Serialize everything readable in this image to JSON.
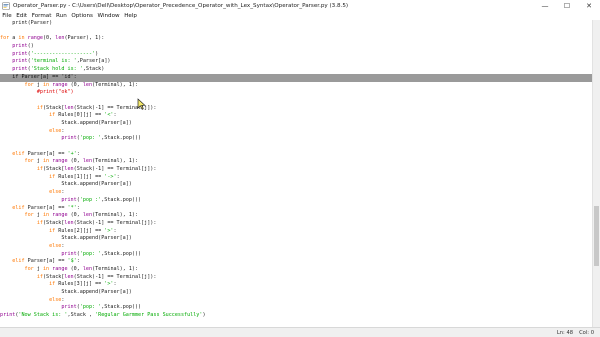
{
  "window": {
    "title": "Operator_Parser.py - C:\\Users\\Dell\\Desktop\\Operator_Precedence_Operator_with_Lex_Syntax\\Operator_Parser.py (3.8.5)",
    "minimize": "—",
    "maximize": "☐",
    "close": "✕"
  },
  "menu": [
    "File",
    "Edit",
    "Format",
    "Run",
    "Options",
    "Window",
    "Help"
  ],
  "code": [
    [
      {
        "t": "    print(Parser)"
      }
    ],
    [
      {
        "t": ""
      }
    ],
    [
      {
        "t": "for",
        "c": "kw"
      },
      {
        "t": " a "
      },
      {
        "t": "in",
        "c": "kw"
      },
      {
        "t": " "
      },
      {
        "t": "range",
        "c": "bi"
      },
      {
        "t": "(0, "
      },
      {
        "t": "len",
        "c": "bi"
      },
      {
        "t": "(Parser), 1):"
      }
    ],
    [
      {
        "t": "    "
      },
      {
        "t": "print",
        "c": "bi"
      },
      {
        "t": "()"
      }
    ],
    [
      {
        "t": "    "
      },
      {
        "t": "print",
        "c": "bi"
      },
      {
        "t": "("
      },
      {
        "t": "'-------------------'",
        "c": "str"
      },
      {
        "t": ")"
      }
    ],
    [
      {
        "t": "    "
      },
      {
        "t": "print",
        "c": "bi"
      },
      {
        "t": "("
      },
      {
        "t": "'terminal is: '",
        "c": "str"
      },
      {
        "t": ",Parser[a])"
      }
    ],
    [
      {
        "t": "    "
      },
      {
        "t": "print",
        "c": "bi"
      },
      {
        "t": "("
      },
      {
        "t": "'Stack hold is: '",
        "c": "str"
      },
      {
        "t": ",Stack)"
      }
    ],
    [
      {
        "t": "    if Parser[a] == 'id':"
      }
    ],
    [
      {
        "t": "        "
      },
      {
        "t": "for",
        "c": "kw"
      },
      {
        "t": " j "
      },
      {
        "t": "in",
        "c": "kw"
      },
      {
        "t": " "
      },
      {
        "t": "range",
        "c": "bi"
      },
      {
        "t": " (0, "
      },
      {
        "t": "len",
        "c": "bi"
      },
      {
        "t": "(Terminal), 1):"
      }
    ],
    [
      {
        "t": "            "
      },
      {
        "t": "#print(\"ok\")",
        "c": "cm"
      }
    ],
    [
      {
        "t": ""
      }
    ],
    [
      {
        "t": "            "
      },
      {
        "t": "if",
        "c": "kw"
      },
      {
        "t": "(Stack["
      },
      {
        "t": "len",
        "c": "bi"
      },
      {
        "t": "(Stack)-1] == Terminal[j]):"
      }
    ],
    [
      {
        "t": "                "
      },
      {
        "t": "if",
        "c": "kw"
      },
      {
        "t": " Rules[0][j] == "
      },
      {
        "t": "'<'",
        "c": "str"
      },
      {
        "t": ":"
      }
    ],
    [
      {
        "t": "                    Stack.append(Parser[a])"
      }
    ],
    [
      {
        "t": "                "
      },
      {
        "t": "else",
        "c": "kw"
      },
      {
        "t": ":"
      }
    ],
    [
      {
        "t": "                    "
      },
      {
        "t": "print",
        "c": "bi"
      },
      {
        "t": "("
      },
      {
        "t": "'pop: '",
        "c": "str"
      },
      {
        "t": ",Stack.pop())"
      }
    ],
    [
      {
        "t": ""
      }
    ],
    [
      {
        "t": "    "
      },
      {
        "t": "elif",
        "c": "kw"
      },
      {
        "t": " Parser[a] == "
      },
      {
        "t": "'+'",
        "c": "str"
      },
      {
        "t": ":"
      }
    ],
    [
      {
        "t": "        "
      },
      {
        "t": "for",
        "c": "kw"
      },
      {
        "t": " j "
      },
      {
        "t": "in",
        "c": "kw"
      },
      {
        "t": " "
      },
      {
        "t": "range",
        "c": "bi"
      },
      {
        "t": " (0, "
      },
      {
        "t": "len",
        "c": "bi"
      },
      {
        "t": "(Terminal), 1):"
      }
    ],
    [
      {
        "t": "            "
      },
      {
        "t": "if",
        "c": "kw"
      },
      {
        "t": "(Stack["
      },
      {
        "t": "len",
        "c": "bi"
      },
      {
        "t": "(Stack)-1] == Terminal[j]):"
      }
    ],
    [
      {
        "t": "                "
      },
      {
        "t": "if",
        "c": "kw"
      },
      {
        "t": " Rules[1][j] == "
      },
      {
        "t": "'->'",
        "c": "str"
      },
      {
        "t": ":"
      }
    ],
    [
      {
        "t": "                    Stack.append(Parser[a])"
      }
    ],
    [
      {
        "t": "                "
      },
      {
        "t": "else",
        "c": "kw"
      },
      {
        "t": ":"
      }
    ],
    [
      {
        "t": "                    "
      },
      {
        "t": "print",
        "c": "bi"
      },
      {
        "t": "("
      },
      {
        "t": "'pop :'",
        "c": "str"
      },
      {
        "t": ",Stack.pop())"
      }
    ],
    [
      {
        "t": "    "
      },
      {
        "t": "elif",
        "c": "kw"
      },
      {
        "t": " Parser[a] == "
      },
      {
        "t": "'*'",
        "c": "str"
      },
      {
        "t": ":"
      }
    ],
    [
      {
        "t": "        "
      },
      {
        "t": "for",
        "c": "kw"
      },
      {
        "t": " j "
      },
      {
        "t": "in",
        "c": "kw"
      },
      {
        "t": " "
      },
      {
        "t": "range",
        "c": "bi"
      },
      {
        "t": " (0, "
      },
      {
        "t": "len",
        "c": "bi"
      },
      {
        "t": "(Terminal), 1):"
      }
    ],
    [
      {
        "t": "            "
      },
      {
        "t": "if",
        "c": "kw"
      },
      {
        "t": "(Stack["
      },
      {
        "t": "len",
        "c": "bi"
      },
      {
        "t": "(Stack)-1] == Terminal[j]):"
      }
    ],
    [
      {
        "t": "                "
      },
      {
        "t": "if",
        "c": "kw"
      },
      {
        "t": " Rules[2][j] == "
      },
      {
        "t": "'>'",
        "c": "str"
      },
      {
        "t": ":"
      }
    ],
    [
      {
        "t": "                    Stack.append(Parser[a])"
      }
    ],
    [
      {
        "t": "                "
      },
      {
        "t": "else",
        "c": "kw"
      },
      {
        "t": ":"
      }
    ],
    [
      {
        "t": "                    "
      },
      {
        "t": "print",
        "c": "bi"
      },
      {
        "t": "("
      },
      {
        "t": "'pop: '",
        "c": "str"
      },
      {
        "t": ",Stack.pop())"
      }
    ],
    [
      {
        "t": "    "
      },
      {
        "t": "elif",
        "c": "kw"
      },
      {
        "t": " Parser[a] == "
      },
      {
        "t": "'$'",
        "c": "str"
      },
      {
        "t": ":"
      }
    ],
    [
      {
        "t": "        "
      },
      {
        "t": "for",
        "c": "kw"
      },
      {
        "t": " j "
      },
      {
        "t": "in",
        "c": "kw"
      },
      {
        "t": " "
      },
      {
        "t": "range",
        "c": "bi"
      },
      {
        "t": " (0, "
      },
      {
        "t": "len",
        "c": "bi"
      },
      {
        "t": "(Terminal), 1):"
      }
    ],
    [
      {
        "t": "            "
      },
      {
        "t": "if",
        "c": "kw"
      },
      {
        "t": "(Stack["
      },
      {
        "t": "len",
        "c": "bi"
      },
      {
        "t": "(Stack)-1] == Terminal[j]):"
      }
    ],
    [
      {
        "t": "                "
      },
      {
        "t": "if",
        "c": "kw"
      },
      {
        "t": " Rules[3][j] == "
      },
      {
        "t": "'>'",
        "c": "str"
      },
      {
        "t": ":"
      }
    ],
    [
      {
        "t": "                    Stack.append(Parser[a])"
      }
    ],
    [
      {
        "t": "                "
      },
      {
        "t": "else",
        "c": "kw"
      },
      {
        "t": ":"
      }
    ],
    [
      {
        "t": "                    "
      },
      {
        "t": "print",
        "c": "bi"
      },
      {
        "t": "("
      },
      {
        "t": "'pop: '",
        "c": "str"
      },
      {
        "t": ",Stack.pop())"
      }
    ],
    [
      {
        "t": "print",
        "c": "bi"
      },
      {
        "t": "("
      },
      {
        "t": "'Now Stack is: '",
        "c": "str"
      },
      {
        "t": ",Stack , "
      },
      {
        "t": "'Regular Garmmer Pass Successfully'",
        "c": "str"
      },
      {
        "t": ")"
      }
    ]
  ],
  "highlight_line": 7,
  "status": {
    "line": "Ln: 48",
    "col": "Col: 0"
  }
}
